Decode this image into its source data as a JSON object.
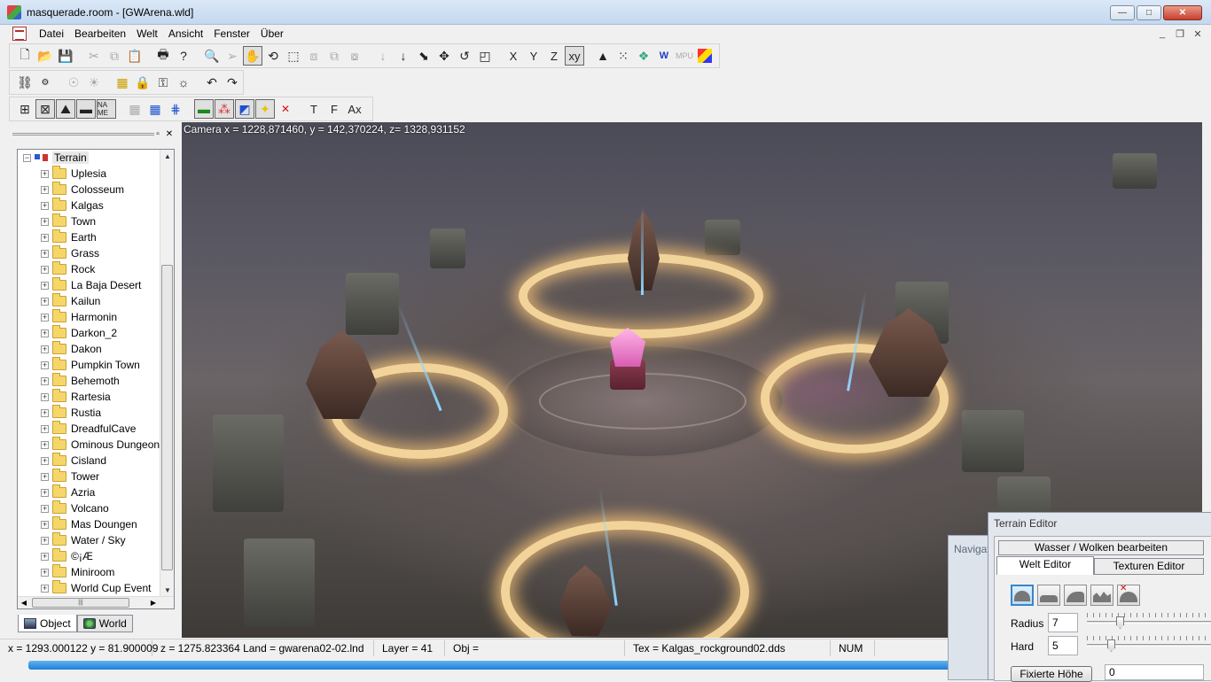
{
  "window": {
    "title": "masquerade.room - [GWArena.wld]",
    "btn_minimize": "—",
    "btn_maximize": "□",
    "btn_close": "✕"
  },
  "menu": {
    "items": [
      "Datei",
      "Bearbeiten",
      "Welt",
      "Ansicht",
      "Fenster",
      "Über"
    ],
    "mdi_minimize": "_",
    "mdi_restore": "❐",
    "mdi_close": "✕"
  },
  "toolbar3_labels": {
    "name_me": "NA ME",
    "t": "T",
    "f": "F",
    "ax": "Ax"
  },
  "toolbar1_labels": {
    "x": "X",
    "y": "Y",
    "z": "Z",
    "xy": "xy",
    "w": "W",
    "mpu": "MPU"
  },
  "tree": {
    "root": "Terrain",
    "items": [
      "Uplesia",
      "Colosseum",
      "Kalgas",
      "Town",
      "Earth",
      "Grass",
      "Rock",
      "La Baja Desert",
      "Kailun",
      "Harmonin",
      "Darkon_2",
      "Dakon",
      "Pumpkin Town",
      "Behemoth",
      "Rartesia",
      "Rustia",
      "DreadfulCave",
      "Ominous Dungeon",
      "Cisland",
      "Tower",
      "Azria",
      "Volcano",
      "Mas Doungen",
      "Water / Sky",
      "©¡Æ",
      "Miniroom",
      "World Cup Event"
    ]
  },
  "tabs": {
    "object": "Object",
    "world": "World"
  },
  "viewport": {
    "camera": "Camera x = 1228,871460, y = 142,370224, z= 1328,931152"
  },
  "status": {
    "xy": "x = 1293.000122 y = 81.900009",
    "z_land": "z = 1275.823364 Land = gwarena02-02.lnd",
    "layer": "Layer = 41",
    "obj": "Obj =",
    "tex": "Tex = Kalgas_rockground02.dds",
    "num": "NUM"
  },
  "navigator": {
    "title": "Navigat"
  },
  "terrain_editor": {
    "title": "Terrain Editor",
    "tab_water": "Wasser / Wolken bearbeiten",
    "tab_welt": "Welt Editor",
    "tab_textures": "Texturen Editor",
    "radius_label": "Radius",
    "radius_value": "7",
    "radius_level": 0.25,
    "hard_label": "Hard",
    "hard_value": "5",
    "hard_level": 0.18,
    "fix_height_button": "Fixierte Höhe",
    "fix_height_value": "0"
  }
}
